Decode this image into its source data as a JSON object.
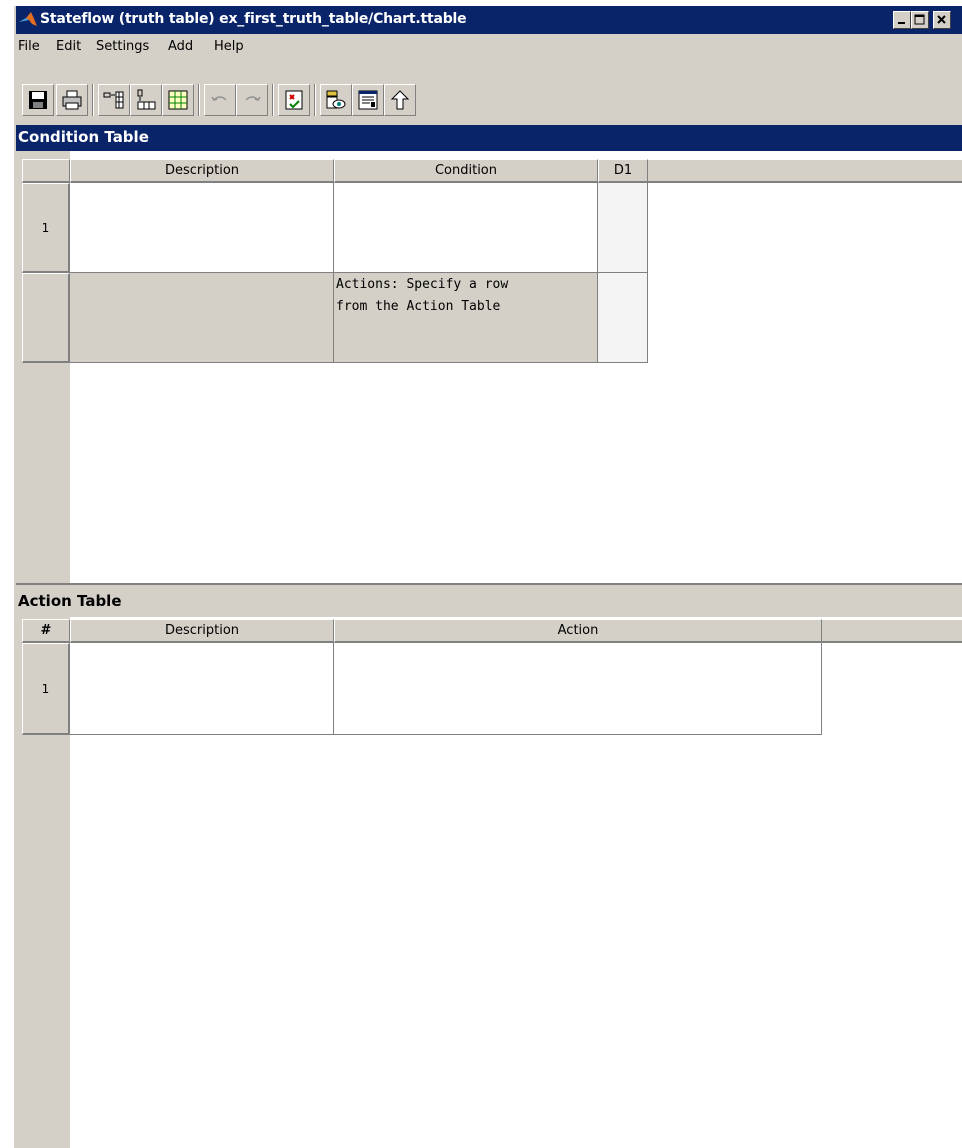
{
  "window": {
    "title": "Stateflow (truth table) ex_first_truth_table/Chart.ttable",
    "controls": [
      "minimize-icon",
      "maximize-icon",
      "close-icon"
    ]
  },
  "menu": [
    "File",
    "Edit",
    "Settings",
    "Add",
    "Help"
  ],
  "toolbar": {
    "buttons": [
      "save-icon",
      "print-icon",
      "insert-row-icon",
      "insert-column-icon",
      "add-cell-icon",
      "undo-icon",
      "redo-icon",
      "check-diagnostics-icon",
      "edit-data-icon",
      "model-explorer-icon",
      "go-to-parent-icon"
    ]
  },
  "condition_table": {
    "title": "Condition Table",
    "headers": [
      "Description",
      "Condition",
      "D1"
    ],
    "rows": [
      {
        "num": "1",
        "description": "",
        "condition": "",
        "d1": ""
      }
    ],
    "actions_row": {
      "condition_text": "Actions: Specify a row\nfrom the Action Table",
      "d1": ""
    }
  },
  "action_table": {
    "title": "Action Table",
    "headers": [
      "#",
      "Description",
      "Action"
    ],
    "rows": [
      {
        "num": "1",
        "description": "",
        "action": ""
      }
    ]
  }
}
